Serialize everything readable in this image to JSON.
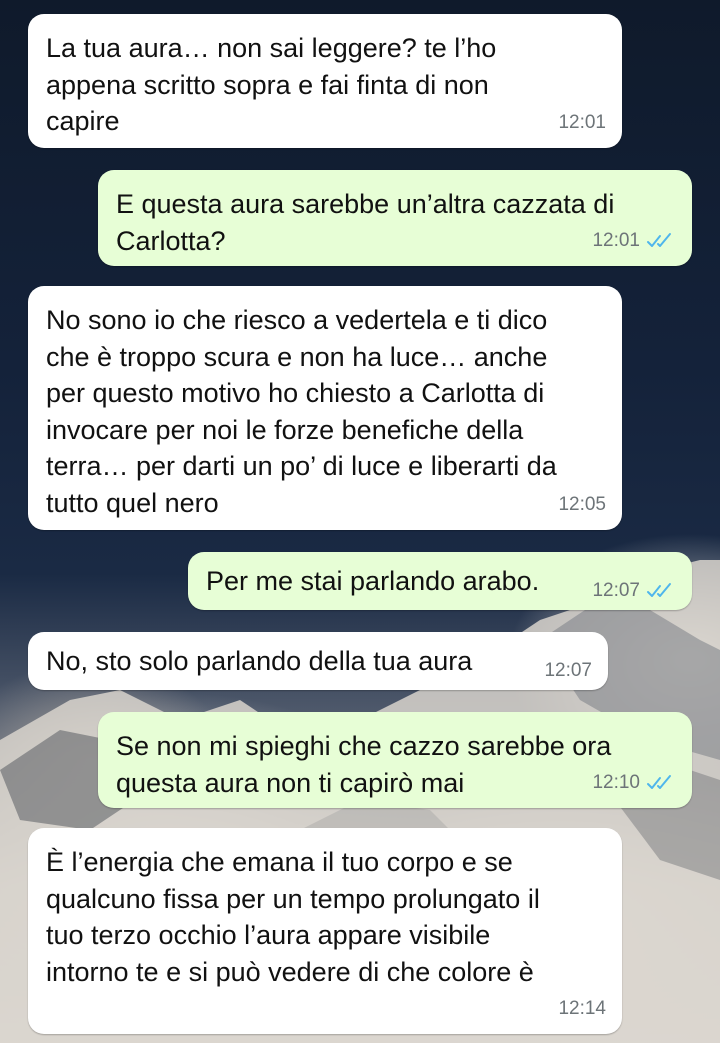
{
  "colors": {
    "incoming_bubble": "#ffffff",
    "outgoing_bubble": "#e7fed6",
    "read_ticks": "#4fb6ec",
    "timestamp": "#6d7478"
  },
  "icons": {
    "read_receipt": "double-check-icon"
  },
  "messages": [
    {
      "direction": "incoming",
      "text": "La tua aura… non sai leggere? te l’ho\nappena scritto sopra e fai finta di non\ncapire",
      "time": "12:01"
    },
    {
      "direction": "outgoing",
      "text": "E questa aura sarebbe un’altra cazzata di\nCarlotta?",
      "time": "12:01",
      "read": true
    },
    {
      "direction": "incoming",
      "text": "No sono io che riesco a vedertela e ti dico\nche è troppo scura e non ha luce… anche\nper questo motivo ho chiesto a Carlotta di\ninvocare per noi le forze benefiche della\nterra… per darti un po’ di luce e liberarti da\ntutto quel nero",
      "time": "12:05"
    },
    {
      "direction": "outgoing",
      "text": "Per me stai parlando arabo.",
      "time": "12:07",
      "read": true
    },
    {
      "direction": "incoming",
      "text": "No, sto solo parlando della tua aura",
      "time": "12:07"
    },
    {
      "direction": "outgoing",
      "text": "Se non mi spieghi che cazzo sarebbe ora\nquesta aura non ti capirò mai",
      "time": "12:10",
      "read": true
    },
    {
      "direction": "incoming",
      "text": "È l’energia che emana il tuo corpo e se\nqualcuno fissa per un tempo prolungato il\ntuo terzo occhio l’aura appare visibile\nintorno te e si può vedere di che colore è",
      "time": "12:14"
    }
  ]
}
